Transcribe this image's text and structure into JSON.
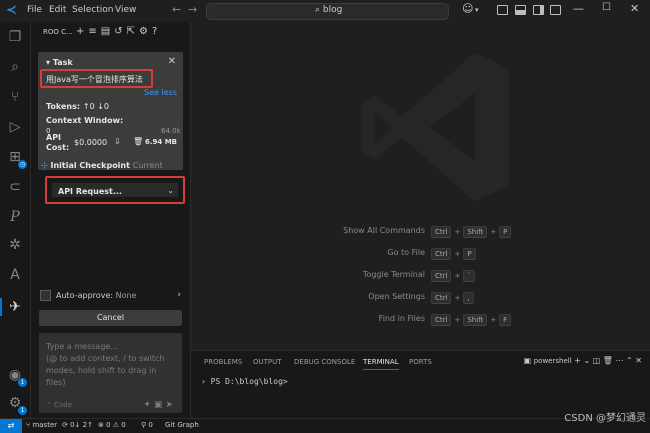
{
  "menu": {
    "file": "File",
    "edit": "Edit",
    "selection": "Selection",
    "view": "View"
  },
  "search": {
    "text": "blog"
  },
  "roo": {
    "header": "ROO C...",
    "task": {
      "title": "Task",
      "content": "用Java写一个冒泡排序算法",
      "see_less": "See less",
      "tokens_label": "Tokens:",
      "tokens_value": "↑0 ↓0",
      "context_label": "Context Window:",
      "context_value": "0",
      "context_max": "64.0k",
      "api_cost_label": "API Cost:",
      "api_cost_value": "$0.0000",
      "size": "6.94 MB"
    },
    "checkpoint": {
      "label": "Initial Checkpoint",
      "current": "Current"
    },
    "api_request": "API Request...",
    "auto_approve": {
      "label": "Auto-approve:",
      "value": "None"
    },
    "cancel": "Cancel",
    "message_placeholder": "Type a message...\n(@ to add context, / to switch modes, hold shift to drag in files)",
    "mode": "Code"
  },
  "commands": [
    {
      "name": "Show All Commands",
      "keys": [
        "Ctrl",
        "Shift",
        "P"
      ]
    },
    {
      "name": "Go to File",
      "keys": [
        "Ctrl",
        "P"
      ]
    },
    {
      "name": "Toggle Terminal",
      "keys": [
        "Ctrl",
        "`"
      ]
    },
    {
      "name": "Open Settings",
      "keys": [
        "Ctrl",
        ","
      ]
    },
    {
      "name": "Find in Files",
      "keys": [
        "Ctrl",
        "Shift",
        "F"
      ]
    }
  ],
  "panel": {
    "tabs": [
      "PROBLEMS",
      "OUTPUT",
      "DEBUG CONSOLE",
      "TERMINAL",
      "PORTS"
    ],
    "active_tab": "TERMINAL",
    "shell": "powershell",
    "prompt": "PS D:\\blog\\blog>"
  },
  "status": {
    "branch": "master",
    "sync": "0↓ 2↑",
    "errors": "0",
    "warnings": "0",
    "ports": "0",
    "git_graph": "Git Graph",
    "watermark": "CSDN @梦幻通灵"
  },
  "colors": {
    "accent": "#0078d4",
    "highlight_box": "#d93a3a",
    "link": "#3794ff"
  }
}
